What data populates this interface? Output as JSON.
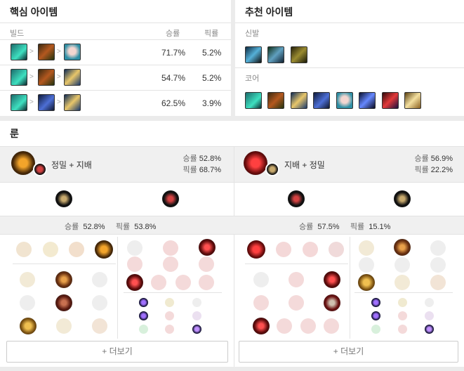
{
  "core_items": {
    "title": "핵심 아이템",
    "col_build": "빌드",
    "col_win": "승률",
    "col_pick": "픽률",
    "rows": [
      {
        "items": [
          "green-gun-icon",
          "lute-icon",
          "jinx-portrait-icon"
        ],
        "win": "71.7%",
        "pick": "5.2%"
      },
      {
        "items": [
          "green-gun-icon",
          "lute-icon",
          "scepter-icon"
        ],
        "win": "54.7%",
        "pick": "5.2%"
      },
      {
        "items": [
          "green-gun-icon",
          "blue-blade-icon",
          "scepter-icon"
        ],
        "win": "62.5%",
        "pick": "3.9%"
      }
    ]
  },
  "rec_items": {
    "title": "추천 아이템",
    "boots_label": "신발",
    "core_label": "코어"
  },
  "runes": {
    "title": "룬",
    "more_label": "+ 더보기",
    "pages": [
      {
        "name": "정밀 + 지배",
        "win_label": "승률",
        "win": "52.8%",
        "pick_label": "픽률",
        "pick": "68.7%",
        "stat_win_label": "승률",
        "stat_win": "52.8%",
        "stat_pick_label": "픽률",
        "stat_pick": "53.8%"
      },
      {
        "name": "지배 + 정밀",
        "win_label": "승률",
        "win": "56.9%",
        "pick_label": "픽률",
        "pick": "22.2%",
        "stat_win_label": "승률",
        "stat_win": "57.5%",
        "stat_pick_label": "픽률",
        "stat_pick": "15.1%"
      }
    ]
  },
  "colors": {
    "precision": "#c8aa6e",
    "domination": "#d44242",
    "border": "#e3e3e3"
  }
}
